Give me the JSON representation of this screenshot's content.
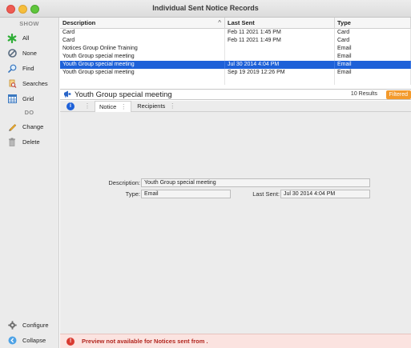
{
  "window": {
    "title": "Individual Sent Notice Records"
  },
  "sidebar": {
    "show_header": "SHOW",
    "show_items": [
      {
        "label": "All",
        "icon": "asterisk-icon"
      },
      {
        "label": "None",
        "icon": "no-sign-icon"
      },
      {
        "label": "Find",
        "icon": "magnifier-icon"
      },
      {
        "label": "Searches",
        "icon": "searches-icon"
      },
      {
        "label": "Grid",
        "icon": "grid-icon"
      }
    ],
    "do_header": "DO",
    "do_items": [
      {
        "label": "Change",
        "icon": "pencil-icon"
      },
      {
        "label": "Delete",
        "icon": "trash-icon"
      }
    ],
    "bottom_items": [
      {
        "label": "Configure",
        "icon": "gear-icon"
      },
      {
        "label": "Collapse",
        "icon": "collapse-icon"
      }
    ]
  },
  "table": {
    "columns": [
      "Description",
      "Last Sent",
      "Type"
    ],
    "sort_indicator": "^",
    "rows": [
      {
        "description": "Card",
        "last_sent": "Feb 11 2021 1:45 PM",
        "type": "Card"
      },
      {
        "description": "Card",
        "last_sent": "Feb 11 2021 1:49 PM",
        "type": "Card"
      },
      {
        "description": "Notices Group Online Training",
        "last_sent": "",
        "type": "Email"
      },
      {
        "description": "Youth Group special meeting",
        "last_sent": "",
        "type": "Email"
      },
      {
        "description": "Youth Group special meeting",
        "last_sent": "Jul 30 2014 4:04 PM",
        "type": "Email",
        "selected": true
      },
      {
        "description": "Youth Group special meeting",
        "last_sent": "Sep 19 2019 12:26 PM",
        "type": "Email"
      }
    ]
  },
  "detail": {
    "title": "Youth Group special meeting",
    "results": "10 Results",
    "filter_badge": "Filtered",
    "tabs": [
      "Notice",
      "Recipients"
    ]
  },
  "form": {
    "description_label": "Description:",
    "description_value": "Youth Group special meeting",
    "type_label": "Type:",
    "type_value": "Email",
    "last_sent_label": "Last Sent:",
    "last_sent_value": "Jul 30 2014 4:04 PM"
  },
  "status": {
    "message": "Preview not available for Notices sent from ."
  },
  "colors": {
    "selection": "#1e61d8",
    "filtered": "#f39a2c",
    "warning": "#d93a30"
  }
}
